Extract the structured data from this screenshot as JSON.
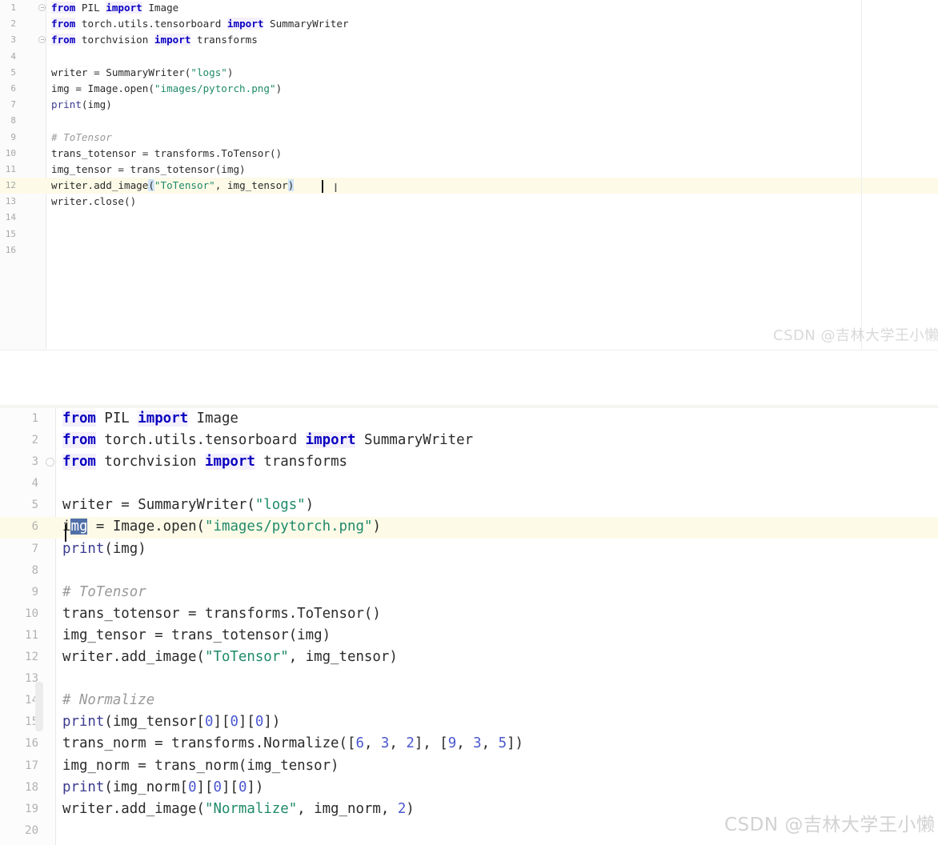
{
  "app": {
    "kind": "python-code-editor",
    "language": "Python",
    "panes": 2
  },
  "colors": {
    "keyword": "#0a00c0",
    "string": "#1f8a6a",
    "number": "#4a57cf",
    "comment": "#9a9a9a",
    "function": "#3b3b8f",
    "plain": "#2b2b2b",
    "bracket_match_bg": "#cfe3f7",
    "selection_bg": "#4f6fa8",
    "current_line_bg": "#fdfbe8",
    "gutter_text": "#a6a6a6",
    "tab_indicator": "#3d6fa8",
    "watermark": "#d9d9d9"
  },
  "top_pane": {
    "name": "upper-code-editor",
    "current_line": 12,
    "fold_markers": [
      1,
      3
    ],
    "line_count": 16,
    "right_margin_guide_column": true,
    "lines": [
      {
        "n": "1",
        "tokens": [
          {
            "t": "from",
            "c": "kw"
          },
          {
            "t": " PIL ",
            "c": "pl"
          },
          {
            "t": "import",
            "c": "kw"
          },
          {
            "t": " Image",
            "c": "pl"
          }
        ]
      },
      {
        "n": "2",
        "tokens": [
          {
            "t": "from",
            "c": "kw"
          },
          {
            "t": " torch.utils.tensorboard ",
            "c": "pl"
          },
          {
            "t": "import",
            "c": "kw"
          },
          {
            "t": " SummaryWriter",
            "c": "pl"
          }
        ]
      },
      {
        "n": "3",
        "tokens": [
          {
            "t": "from",
            "c": "kw"
          },
          {
            "t": " torchvision ",
            "c": "pl"
          },
          {
            "t": "import",
            "c": "kw"
          },
          {
            "t": " transforms",
            "c": "pl"
          }
        ]
      },
      {
        "n": "4",
        "tokens": []
      },
      {
        "n": "5",
        "tokens": [
          {
            "t": "writer = SummaryWriter(",
            "c": "pl"
          },
          {
            "t": "\"logs\"",
            "c": "str"
          },
          {
            "t": ")",
            "c": "pl"
          }
        ]
      },
      {
        "n": "6",
        "tokens": [
          {
            "t": "img = Image.open(",
            "c": "pl"
          },
          {
            "t": "\"images/pytorch.png\"",
            "c": "str"
          },
          {
            "t": ")",
            "c": "pl"
          }
        ]
      },
      {
        "n": "7",
        "tokens": [
          {
            "t": "print",
            "c": "fn"
          },
          {
            "t": "(img)",
            "c": "pl"
          }
        ]
      },
      {
        "n": "8",
        "tokens": []
      },
      {
        "n": "9",
        "tokens": [
          {
            "t": "# ToTensor",
            "c": "com"
          }
        ]
      },
      {
        "n": "10",
        "tokens": [
          {
            "t": "trans_totensor = transforms.ToTensor()",
            "c": "pl"
          }
        ]
      },
      {
        "n": "11",
        "tokens": [
          {
            "t": "img_tensor = trans_totensor(img)",
            "c": "pl"
          }
        ]
      },
      {
        "n": "12",
        "tokens": [
          {
            "t": "writer.add_image",
            "c": "pl"
          },
          {
            "t": "(",
            "c": "brk"
          },
          {
            "t": "\"ToTensor\"",
            "c": "str"
          },
          {
            "t": ", img_tensor",
            "c": "pl"
          },
          {
            "t": ")",
            "c": "brk"
          }
        ]
      },
      {
        "n": "13",
        "tokens": [
          {
            "t": "writer.close()",
            "c": "pl"
          }
        ]
      },
      {
        "n": "14",
        "tokens": []
      },
      {
        "n": "15",
        "tokens": []
      },
      {
        "n": "16",
        "tokens": []
      }
    ]
  },
  "bottom_pane": {
    "name": "lower-code-editor",
    "current_line": 6,
    "fold_markers": [
      3
    ],
    "line_count": 20,
    "selection": {
      "line": 6,
      "text": "mg"
    },
    "lines": [
      {
        "n": "1",
        "tokens": [
          {
            "t": "from",
            "c": "kw"
          },
          {
            "t": " PIL ",
            "c": "pl"
          },
          {
            "t": "import",
            "c": "kw"
          },
          {
            "t": " Image",
            "c": "pl"
          }
        ]
      },
      {
        "n": "2",
        "tokens": [
          {
            "t": "from",
            "c": "kw"
          },
          {
            "t": " torch.utils.tensorboard ",
            "c": "pl"
          },
          {
            "t": "import",
            "c": "kw"
          },
          {
            "t": " SummaryWriter",
            "c": "pl"
          }
        ]
      },
      {
        "n": "3",
        "tokens": [
          {
            "t": "from",
            "c": "kw"
          },
          {
            "t": " torchvision ",
            "c": "pl"
          },
          {
            "t": "import",
            "c": "kw"
          },
          {
            "t": " transforms",
            "c": "pl"
          }
        ]
      },
      {
        "n": "4",
        "tokens": []
      },
      {
        "n": "5",
        "tokens": [
          {
            "t": "writer = SummaryWriter(",
            "c": "pl"
          },
          {
            "t": "\"logs\"",
            "c": "str"
          },
          {
            "t": ")",
            "c": "pl"
          }
        ]
      },
      {
        "n": "6",
        "tokens": [
          {
            "t": "i",
            "c": "pl"
          },
          {
            "t": "mg",
            "c": "sel"
          },
          {
            "t": " = Image.open(",
            "c": "pl"
          },
          {
            "t": "\"images/pytorch.png\"",
            "c": "str"
          },
          {
            "t": ")",
            "c": "pl"
          }
        ]
      },
      {
        "n": "7",
        "tokens": [
          {
            "t": "print",
            "c": "fn"
          },
          {
            "t": "(img)",
            "c": "pl"
          }
        ]
      },
      {
        "n": "8",
        "tokens": []
      },
      {
        "n": "9",
        "tokens": [
          {
            "t": "# ToTensor",
            "c": "com"
          }
        ]
      },
      {
        "n": "10",
        "tokens": [
          {
            "t": "trans_totensor = transforms.ToTensor()",
            "c": "pl"
          }
        ]
      },
      {
        "n": "11",
        "tokens": [
          {
            "t": "img_tensor = trans_totensor(img)",
            "c": "pl"
          }
        ]
      },
      {
        "n": "12",
        "tokens": [
          {
            "t": "writer.add_image(",
            "c": "pl"
          },
          {
            "t": "\"ToTensor\"",
            "c": "str"
          },
          {
            "t": ", img_tensor)",
            "c": "pl"
          }
        ]
      },
      {
        "n": "13",
        "tokens": []
      },
      {
        "n": "14",
        "tokens": [
          {
            "t": "# Normalize",
            "c": "com"
          }
        ]
      },
      {
        "n": "15",
        "tokens": [
          {
            "t": "print",
            "c": "fn"
          },
          {
            "t": "(img_tensor[",
            "c": "pl"
          },
          {
            "t": "0",
            "c": "num"
          },
          {
            "t": "][",
            "c": "pl"
          },
          {
            "t": "0",
            "c": "num"
          },
          {
            "t": "][",
            "c": "pl"
          },
          {
            "t": "0",
            "c": "num"
          },
          {
            "t": "])",
            "c": "pl"
          }
        ]
      },
      {
        "n": "16",
        "tokens": [
          {
            "t": "trans_norm = transforms.Normalize([",
            "c": "pl"
          },
          {
            "t": "6",
            "c": "num"
          },
          {
            "t": ", ",
            "c": "pl"
          },
          {
            "t": "3",
            "c": "num"
          },
          {
            "t": ", ",
            "c": "pl"
          },
          {
            "t": "2",
            "c": "num"
          },
          {
            "t": "], [",
            "c": "pl"
          },
          {
            "t": "9",
            "c": "num"
          },
          {
            "t": ", ",
            "c": "pl"
          },
          {
            "t": "3",
            "c": "num"
          },
          {
            "t": ", ",
            "c": "pl"
          },
          {
            "t": "5",
            "c": "num"
          },
          {
            "t": "])",
            "c": "pl"
          }
        ]
      },
      {
        "n": "17",
        "tokens": [
          {
            "t": "img_norm = trans_norm(img_tensor)",
            "c": "pl"
          }
        ]
      },
      {
        "n": "18",
        "tokens": [
          {
            "t": "print",
            "c": "fn"
          },
          {
            "t": "(img_norm[",
            "c": "pl"
          },
          {
            "t": "0",
            "c": "num"
          },
          {
            "t": "][",
            "c": "pl"
          },
          {
            "t": "0",
            "c": "num"
          },
          {
            "t": "][",
            "c": "pl"
          },
          {
            "t": "0",
            "c": "num"
          },
          {
            "t": "])",
            "c": "pl"
          }
        ]
      },
      {
        "n": "19",
        "tokens": [
          {
            "t": "writer.add_image(",
            "c": "pl"
          },
          {
            "t": "\"Normalize\"",
            "c": "str"
          },
          {
            "t": ", img_norm, ",
            "c": "pl"
          },
          {
            "t": "2",
            "c": "num"
          },
          {
            "t": ")",
            "c": "pl"
          }
        ]
      },
      {
        "n": "20",
        "tokens": []
      }
    ]
  },
  "watermarks": {
    "top": "CSDN @吉林大学王小懒",
    "bottom": "CSDN @吉林大学王小懒"
  },
  "cursor": {
    "mouse_glyph": "I"
  }
}
